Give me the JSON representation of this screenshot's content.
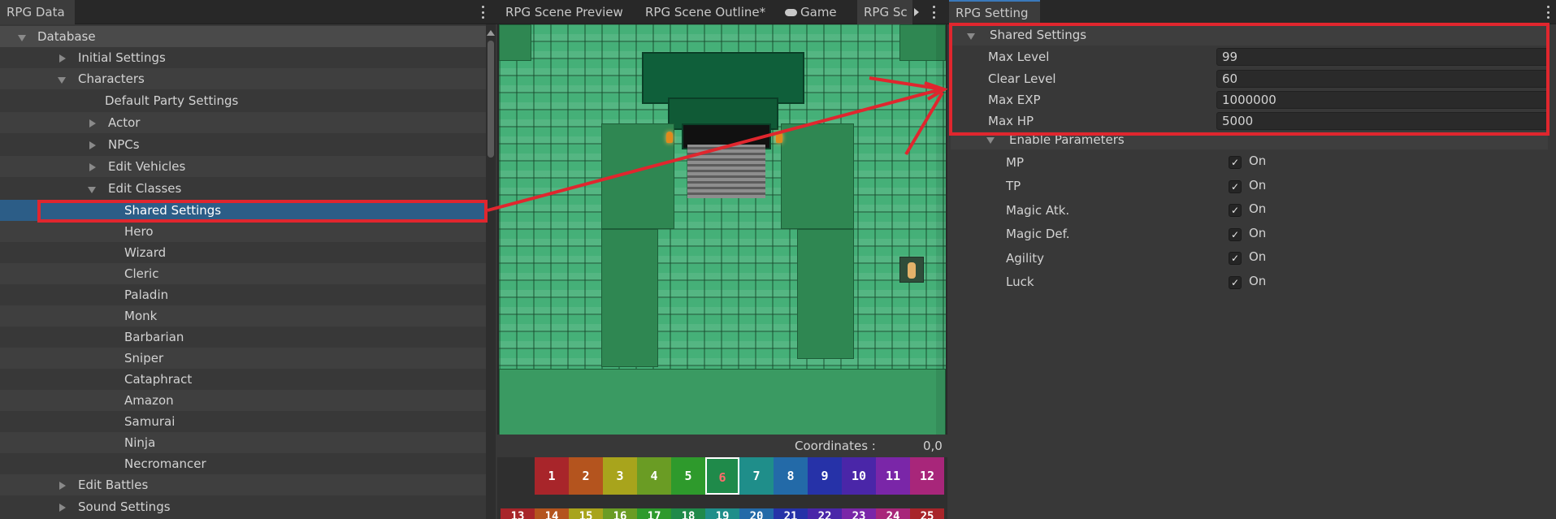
{
  "left_panel": {
    "tab_label": "RPG Data",
    "tree": {
      "root": "Database",
      "items": [
        "Initial Settings",
        "Characters",
        "Default Party Settings",
        "Actor",
        "NPCs",
        "Edit Vehicles",
        "Edit Classes",
        "Shared Settings",
        "Hero",
        "Wizard",
        "Cleric",
        "Paladin",
        "Monk",
        "Barbarian",
        "Sniper",
        "Cataphract",
        "Amazon",
        "Samurai",
        "Ninja",
        "Necromancer",
        "Edit Battles",
        "Sound Settings"
      ]
    }
  },
  "center_panel": {
    "tabs": [
      "RPG Scene Preview",
      "RPG Scene Outline*",
      "Game",
      "RPG Sc"
    ],
    "coordinates_label": "Coordinates :",
    "coordinates_value": "0,0",
    "palette_row1": [
      "1",
      "2",
      "3",
      "4",
      "5",
      "6",
      "7",
      "8",
      "9",
      "10",
      "11",
      "12"
    ],
    "palette_row2": [
      "13",
      "14",
      "15",
      "16",
      "17",
      "18",
      "19",
      "20",
      "21",
      "22",
      "23",
      "24",
      "25"
    ],
    "selected_tile": "6"
  },
  "right_panel": {
    "tab_label": "RPG Setting",
    "section_title": "Shared Settings",
    "fields": [
      {
        "label": "Max Level",
        "value": "99"
      },
      {
        "label": "Clear Level",
        "value": "60"
      },
      {
        "label": "Max EXP",
        "value": "1000000"
      },
      {
        "label": "Max HP",
        "value": "5000"
      }
    ],
    "params_title": "Enable Parameters",
    "params": [
      {
        "label": "MP",
        "state": "On"
      },
      {
        "label": "TP",
        "state": "On"
      },
      {
        "label": "Magic Atk.",
        "state": "On"
      },
      {
        "label": "Magic Def.",
        "state": "On"
      },
      {
        "label": "Agility",
        "state": "On"
      },
      {
        "label": "Luck",
        "state": "On"
      }
    ]
  },
  "colors": {
    "highlight": "#e0262e",
    "selection": "#2c5d87",
    "map_tile": "#45b078"
  }
}
